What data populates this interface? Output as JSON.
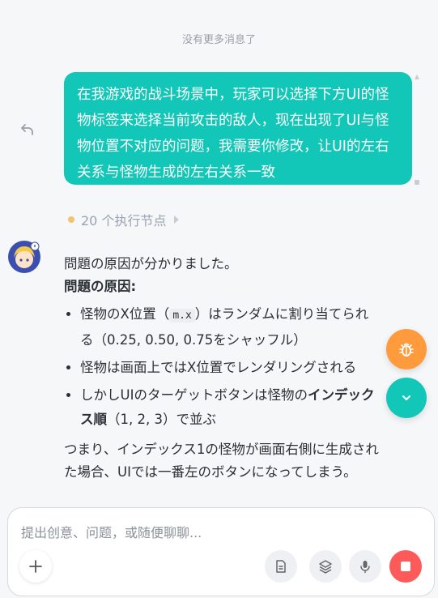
{
  "chat": {
    "no_more_messages": "没有更多消息了",
    "user_message": "在我游戏的战斗场景中，玩家可以选择下方UI的怪物标签来选择当前攻击的敌人，现在出现了UI与怪物位置不对应的问题，我需要你修改，让UI的左右关系与怪物生成的左右关系一致",
    "exec_nodes": "20 个执行节点"
  },
  "reply": {
    "intro": "問題の原因が分かりました。",
    "cause_heading": "問題の原因:",
    "bullet1_pre": "怪物のX位置（",
    "bullet1_code": "m.x",
    "bullet1_post": "）はランダムに割り当てられる（0.25, 0.50, 0.75をシャッフル）",
    "bullet2": "怪物は画面上ではX位置でレンダリングされる",
    "bullet3_pre": "しかしUIのターゲットボタンは怪物の",
    "bullet3_bold": "インデックス順",
    "bullet3_post": "（1, 2, 3）で並ぶ",
    "summary": "つまり、インデックス1の怪物が画面右側に生成された場合、UIでは一番左のボタンになってしまう。"
  },
  "composer": {
    "placeholder": "提出创意、问题，或随便聊聊..."
  },
  "icons": {
    "undo": "undo-icon",
    "bug": "bug-icon",
    "scroll_down": "chevron-down-icon",
    "add": "plus-icon",
    "doc": "document-icon",
    "layers": "layers-icon",
    "mic": "microphone-icon",
    "stop": "stop-icon"
  },
  "colors": {
    "accent": "#12c7b8",
    "bug_button": "#ff9b3d",
    "stop_button": "#ff5a5a",
    "node_dot": "#f2c46b"
  }
}
